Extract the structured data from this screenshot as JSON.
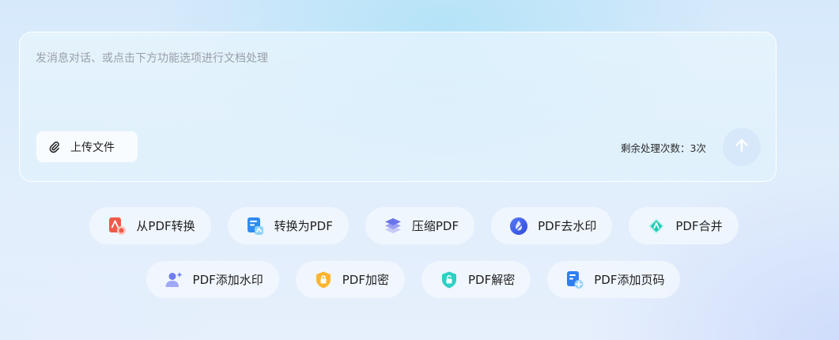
{
  "chat": {
    "placeholder": "发消息对话、或点击下方功能选项进行文档处理",
    "upload_label": "上传文件",
    "remaining_label": "剩余处理次数：",
    "remaining_count": "3次"
  },
  "actions_row1": [
    {
      "label": "从PDF转换",
      "icon": "pdf-convert-from-icon"
    },
    {
      "label": "转换为PDF",
      "icon": "convert-to-pdf-icon"
    },
    {
      "label": "压缩PDF",
      "icon": "compress-layers-icon"
    },
    {
      "label": "PDF去水印",
      "icon": "remove-watermark-icon"
    },
    {
      "label": "PDF合并",
      "icon": "merge-icon"
    }
  ],
  "actions_row2": [
    {
      "label": "PDF添加水印",
      "icon": "add-watermark-icon"
    },
    {
      "label": "PDF加密",
      "icon": "lock-shield-icon"
    },
    {
      "label": "PDF解密",
      "icon": "unlock-shield-icon"
    },
    {
      "label": "PDF添加页码",
      "icon": "add-page-number-icon"
    }
  ],
  "colors": {
    "send_button_bg": "#d2e4f9",
    "accent_blue": "#3b82f6"
  }
}
